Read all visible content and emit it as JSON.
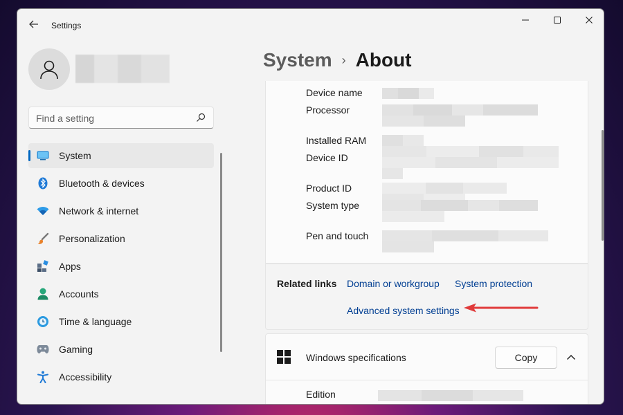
{
  "window": {
    "title": "Settings"
  },
  "sidebar": {
    "search_placeholder": "Find a setting",
    "items": [
      {
        "label": "System",
        "icon": "system-icon",
        "active": true
      },
      {
        "label": "Bluetooth & devices",
        "icon": "bluetooth-icon"
      },
      {
        "label": "Network & internet",
        "icon": "wifi-icon"
      },
      {
        "label": "Personalization",
        "icon": "brush-icon"
      },
      {
        "label": "Apps",
        "icon": "apps-icon"
      },
      {
        "label": "Accounts",
        "icon": "accounts-icon"
      },
      {
        "label": "Time & language",
        "icon": "clock-globe-icon"
      },
      {
        "label": "Gaming",
        "icon": "gamepad-icon"
      },
      {
        "label": "Accessibility",
        "icon": "accessibility-icon"
      }
    ]
  },
  "breadcrumb": {
    "parent": "System",
    "separator": "›",
    "current": "About"
  },
  "device_specs": {
    "labels": [
      "Device name",
      "Processor",
      "Installed RAM",
      "Device ID",
      "Product ID",
      "System type",
      "Pen and touch"
    ]
  },
  "related_links": {
    "title": "Related links",
    "links": [
      "Domain or workgroup",
      "System protection",
      "Advanced system settings"
    ]
  },
  "windows_specs": {
    "title": "Windows specifications",
    "copy_label": "Copy",
    "edition_label": "Edition"
  },
  "colors": {
    "accent": "#0067c0",
    "link": "#003e92",
    "annotation_arrow": "#e03a3a"
  }
}
